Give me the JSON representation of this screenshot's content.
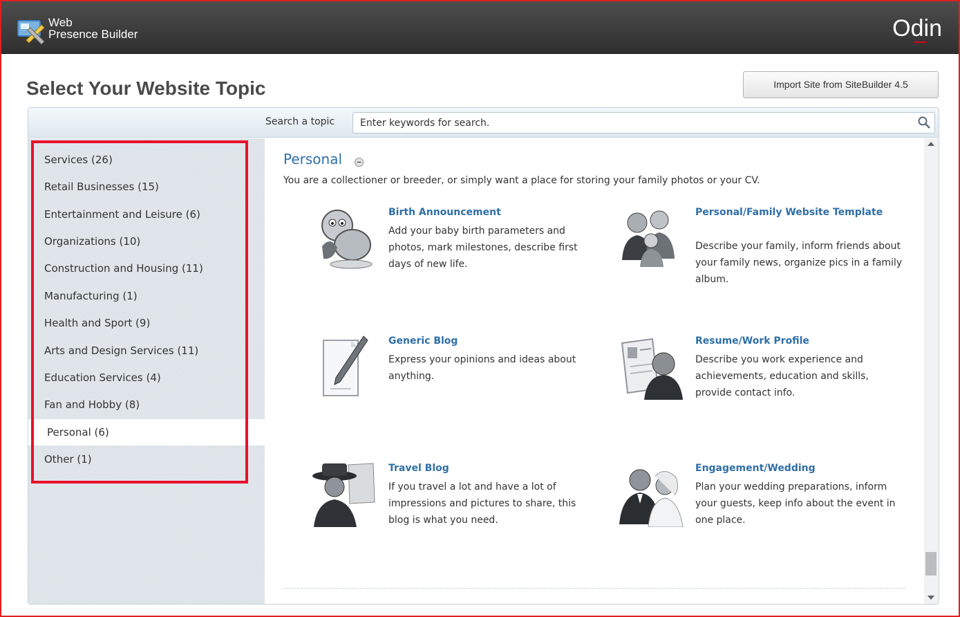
{
  "header": {
    "logo_line1": "Web",
    "logo_line2": "Presence Builder",
    "brand": "Odin"
  },
  "page": {
    "title": "Select Your Website Topic",
    "import_button": "Import Site from SiteBuilder 4.5"
  },
  "search": {
    "label": "Search a topic",
    "placeholder": "Enter keywords for search."
  },
  "sidebar": {
    "items": [
      {
        "label": "Services (26)"
      },
      {
        "label": "Retail Businesses (15)"
      },
      {
        "label": "Entertainment and Leisure (6)"
      },
      {
        "label": "Organizations (10)"
      },
      {
        "label": "Construction and Housing (11)"
      },
      {
        "label": "Manufacturing (1)"
      },
      {
        "label": "Health and Sport (9)"
      },
      {
        "label": "Arts and Design Services (11)"
      },
      {
        "label": "Education Services (4)"
      },
      {
        "label": "Fan and Hobby (8)"
      },
      {
        "label": "Personal (6)",
        "selected": true
      },
      {
        "label": "Other (1)"
      }
    ]
  },
  "content": {
    "section_title": "Personal",
    "section_desc": "You are a collectioner or breeder, or simply want a place for storing your family photos or your CV.",
    "templates": [
      {
        "title": "Birth Announcement",
        "desc": "Add your baby birth parameters and photos, mark milestones, describe first days of new life."
      },
      {
        "title": "Personal/Family Website Template",
        "desc": "Describe your family, inform friends about your family news, organize pics in a family album."
      },
      {
        "title": "Generic Blog",
        "desc": "Express your opinions and ideas about anything."
      },
      {
        "title": "Resume/Work Profile",
        "desc": "Describe you work experience and achievements, education and skills, provide contact info."
      },
      {
        "title": "Travel Blog",
        "desc": "If you travel a lot and have a lot of impressions and pictures to share, this blog is what you need."
      },
      {
        "title": "Engagement/Wedding",
        "desc": "Plan your wedding preparations, inform your guests, keep info about the event in one place."
      }
    ]
  },
  "colors": {
    "accent": "#2f6fa7",
    "highlight": "#e8112d",
    "header_bg": "#3b3b3b",
    "sidebar_bg": "#dde3e8"
  },
  "icons": [
    "builder-logo-icon",
    "search-icon",
    "collapse-icon",
    "baby-icon",
    "family-icon",
    "blog-pen-icon",
    "resume-icon",
    "traveler-icon",
    "wedding-icon"
  ]
}
